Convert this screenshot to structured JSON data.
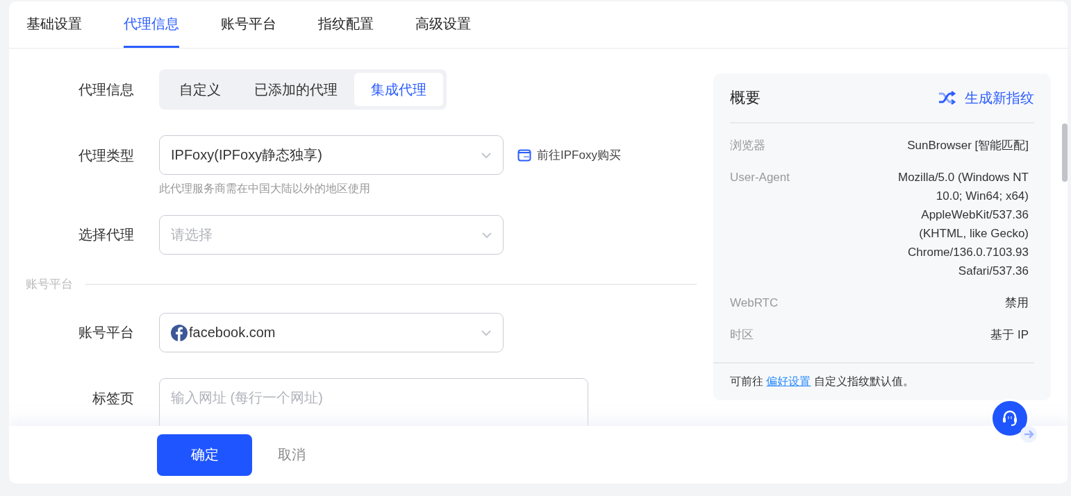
{
  "tabs": [
    {
      "label": "基础设置",
      "selected": false
    },
    {
      "label": "代理信息",
      "selected": true
    },
    {
      "label": "账号平台",
      "selected": false
    },
    {
      "label": "指纹配置",
      "selected": false
    },
    {
      "label": "高级设置",
      "selected": false
    }
  ],
  "form": {
    "proxy_info": {
      "label": "代理信息",
      "options": [
        {
          "label": "自定义",
          "selected": false
        },
        {
          "label": "已添加的代理",
          "selected": false
        },
        {
          "label": "集成代理",
          "selected": true
        }
      ]
    },
    "proxy_type": {
      "label": "代理类型",
      "value": "IPFoxy(IPFoxy静态独享)",
      "hint": "此代理服务商需在中国大陆以外的地区使用",
      "link": "前往IPFoxy购买"
    },
    "select_proxy": {
      "label": "选择代理",
      "placeholder": "请选择"
    },
    "section_title": "账号平台",
    "account_platform": {
      "label": "账号平台",
      "value": "facebook.com"
    },
    "tab_urls": {
      "label": "标签页",
      "placeholder": "输入网址 (每行一个网址)"
    }
  },
  "summary": {
    "title": "概要",
    "action": "生成新指纹",
    "rows": [
      {
        "label": "浏览器",
        "value": "SunBrowser [智能匹配]"
      },
      {
        "label": "User-Agent",
        "value": "Mozilla/5.0 (Windows NT 10.0; Win64; x64) AppleWebKit/537.36 (KHTML, like Gecko) Chrome/136.0.7103.93 Safari/537.36"
      },
      {
        "label": "WebRTC",
        "value": "禁用"
      },
      {
        "label": "时区",
        "value": "基于 IP"
      }
    ],
    "footer": {
      "before": "可前往",
      "link": "偏好设置",
      "after": "自定义指纹默认值。"
    }
  },
  "buttons": {
    "confirm": "确定",
    "cancel": "取消"
  }
}
